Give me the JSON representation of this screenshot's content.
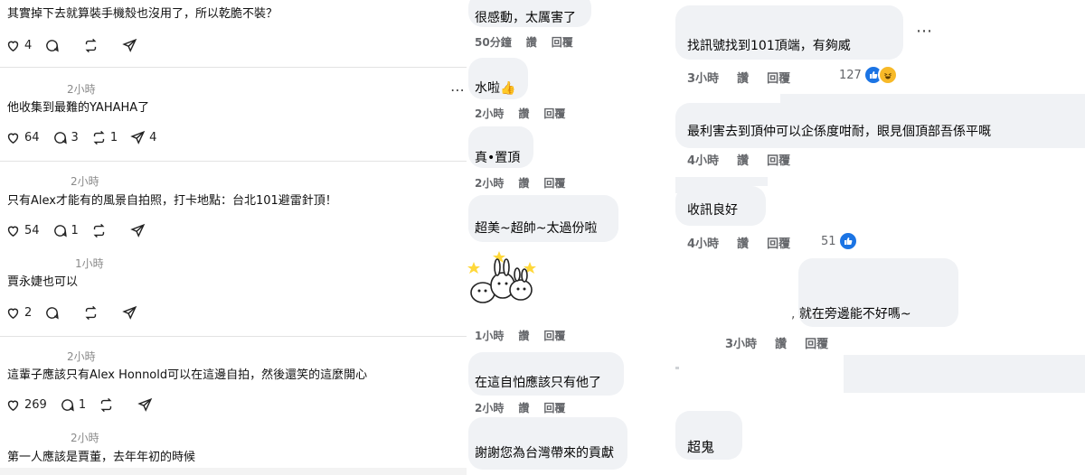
{
  "threads": {
    "posts": [
      {
        "user": "",
        "time": "",
        "text": "其實掉下去就算裝手機殼也沒用了，所以乾脆不裝？",
        "likes": "4",
        "replies": "",
        "reposts": "",
        "shares": ""
      },
      {
        "user": "",
        "time": "2小時",
        "text": "他收集到最難的YAHAHA了",
        "likes": "64",
        "replies": "3",
        "reposts": "1",
        "shares": "4"
      },
      {
        "user": "",
        "time": "2小時",
        "text": "只有Alex才能有的風景自拍照，打卡地點：台北101避雷針頂！",
        "likes": "54",
        "replies": "1",
        "reposts": "",
        "shares": ""
      },
      {
        "user": "",
        "time": "1小時",
        "text": "賈永婕也可以",
        "likes": "2",
        "replies": "",
        "reposts": "",
        "shares": ""
      },
      {
        "user": "",
        "time": "2小時",
        "text": "這輩子應該只有Alex Honnold可以在這邊自拍，然後還笑的這麼開心",
        "likes": "269",
        "replies": "1",
        "reposts": "",
        "shares": ""
      },
      {
        "user": "",
        "time": "2小時",
        "text": "第一人應該是賈董，去年年初的時候",
        "likes": "",
        "replies": "",
        "reposts": "",
        "shares": ""
      }
    ],
    "more_icon": "ellipsis-icon",
    "action_icons": [
      "heart-icon",
      "comment-icon",
      "repost-icon",
      "share-icon"
    ]
  },
  "fb_left": {
    "comments": [
      {
        "text": "很感動，太厲害了",
        "time": "50分鐘",
        "like": "讚",
        "reply": "回覆"
      },
      {
        "text": "水啦",
        "emoji": "👍",
        "time": "2小時",
        "like": "讚",
        "reply": "回覆"
      },
      {
        "text": "真•置頂",
        "time": "2小時",
        "like": "讚",
        "reply": "回覆"
      },
      {
        "text": "超美~超帥~太過份啦",
        "time": "",
        "like": "",
        "reply": ""
      },
      {
        "text": "",
        "sticker": "bunny-sticker",
        "time": "1小時",
        "like": "讚",
        "reply": "回覆"
      },
      {
        "text": "在這自怕應該只有他了",
        "time": "2小時",
        "like": "讚",
        "reply": "回覆"
      },
      {
        "text": "謝謝您為台灣帶來的貢獻",
        "time": "",
        "like": "",
        "reply": ""
      }
    ]
  },
  "fb_right": {
    "comments": [
      {
        "text": "找訊號找到101頂端，有夠威",
        "time": "3小時",
        "like": "讚",
        "reply": "回覆",
        "reaction_count": "127",
        "reactions": [
          "like-icon",
          "haha-icon"
        ]
      },
      {
        "text": "最利害去到頂仲可以企係度咁耐，眼見個頂部吾係平嘅",
        "time": "4小時",
        "like": "讚",
        "reply": "回覆"
      },
      {
        "text": "收訊良好",
        "time": "4小時",
        "like": "讚",
        "reply": "回覆",
        "reaction_count": "51",
        "reactions": [
          "like-icon"
        ]
      },
      {
        "text": "就在旁邊能不好嗎~",
        "time": "3小時",
        "like": "讚",
        "reply": "回覆"
      },
      {
        "text": "超鬼",
        "time": "",
        "like": "",
        "reply": ""
      }
    ],
    "more_icon": "ellipsis-icon"
  },
  "colors": {
    "bubble": "#f0f2f5",
    "meta": "#65676b",
    "like_blue": "#1b74e4",
    "haha_yellow": "#f7b928"
  }
}
